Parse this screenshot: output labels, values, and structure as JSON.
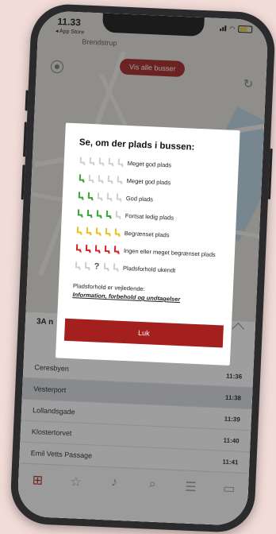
{
  "status": {
    "time": "11.33",
    "back_label": "◂ App Store"
  },
  "map": {
    "place_label": "Brendstrup",
    "show_buses_label": "Vis alle busser"
  },
  "route": {
    "title_prefix": "3A n"
  },
  "stops": [
    {
      "name": "Ceresbyen",
      "time": "11:36"
    },
    {
      "name": "Vesterport",
      "time": "11:38"
    },
    {
      "name": "Lollandsgade",
      "time": "11:39"
    },
    {
      "name": "Klostertorvet",
      "time": "11:40"
    },
    {
      "name": "Emil Vetts Passage",
      "time": "11:41"
    }
  ],
  "modal": {
    "title": "Se, om der plads i bussen:",
    "legend": [
      {
        "label": "Meget god plads",
        "filled": 0,
        "color": "#cfcfcf"
      },
      {
        "label": "Meget god plads",
        "filled": 1,
        "color": "#3aa535"
      },
      {
        "label": "God plads",
        "filled": 2,
        "color": "#3aa535"
      },
      {
        "label": "Fortsat ledig plads",
        "filled": 4,
        "color": "#3aa535"
      },
      {
        "label": "Begrænset plads",
        "filled": 5,
        "color": "#f0bf1e"
      },
      {
        "label": "Ingen eller meget begrænset plads",
        "filled": 5,
        "color": "#d42525"
      },
      {
        "label": "Pladsforhold ukendt",
        "filled": -1,
        "color": "#cfcfcf"
      }
    ],
    "info_label": "Pladsforhold er vejledende:",
    "info_link": "Information, forbehold og undtagelser",
    "close_label": "Luk"
  },
  "colors": {
    "accent": "#a3201e",
    "empty_seat": "#cfcfcf"
  },
  "tabs": [
    "map-icon",
    "star-icon",
    "bell-icon",
    "search-icon",
    "menu-icon",
    "ticket-icon"
  ]
}
